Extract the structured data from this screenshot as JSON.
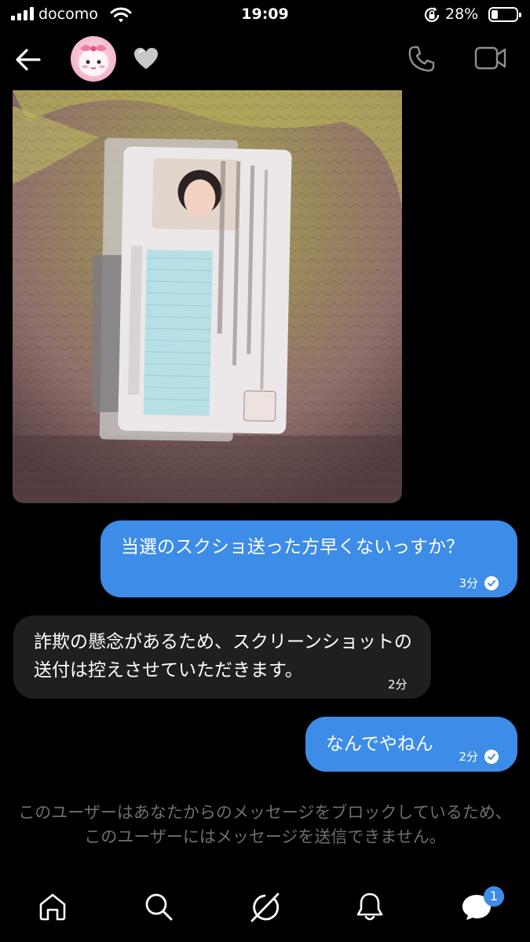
{
  "status_bar": {
    "carrier": "docomo",
    "time": "19:09",
    "battery_percent": "28%",
    "battery_level": 0.28,
    "icons": [
      "signal-icon",
      "wifi-icon",
      "rotation-lock-icon",
      "battery-icon"
    ]
  },
  "header": {
    "icons": [
      "back-arrow-icon",
      "avatar",
      "heart-icon",
      "phone-icon",
      "video-camera-icon"
    ]
  },
  "messages": [
    {
      "sender": "them",
      "type": "image"
    },
    {
      "sender": "me",
      "text": "当選のスクショ送った方早くないっすか？",
      "time": "3分",
      "read": true
    },
    {
      "sender": "them",
      "text": "詐欺の懸念があるため、スクリーンショットの送付は控えさせていただきます。",
      "time": "2分"
    },
    {
      "sender": "me",
      "text": "なんでやねん",
      "time": "2分",
      "read": true
    }
  ],
  "notice": "このユーザーはあなたからのメッセージをブロックしているため、このユーザーにはメッセージを送信できません。",
  "bottom_nav": {
    "items": [
      "home-icon",
      "search-icon",
      "grok-icon",
      "notifications-icon",
      "messages-icon"
    ],
    "messages_badge": "1"
  },
  "colors": {
    "background": "#000000",
    "my_bubble": "#3d8ce8",
    "their_bubble": "#1f1f21",
    "notice_text": "#6e6e72"
  }
}
